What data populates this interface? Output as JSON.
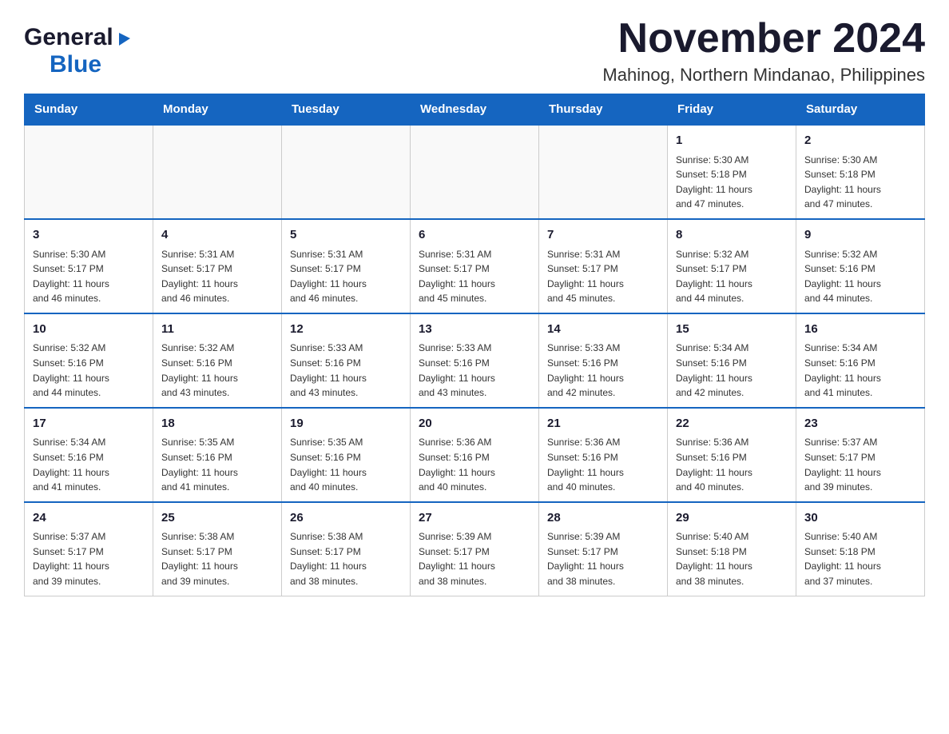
{
  "logo": {
    "general": "General",
    "blue": "Blue"
  },
  "title": "November 2024",
  "subtitle": "Mahinog, Northern Mindanao, Philippines",
  "days_of_week": [
    "Sunday",
    "Monday",
    "Tuesday",
    "Wednesday",
    "Thursday",
    "Friday",
    "Saturday"
  ],
  "weeks": [
    [
      {
        "day": "",
        "info": ""
      },
      {
        "day": "",
        "info": ""
      },
      {
        "day": "",
        "info": ""
      },
      {
        "day": "",
        "info": ""
      },
      {
        "day": "",
        "info": ""
      },
      {
        "day": "1",
        "info": "Sunrise: 5:30 AM\nSunset: 5:18 PM\nDaylight: 11 hours\nand 47 minutes."
      },
      {
        "day": "2",
        "info": "Sunrise: 5:30 AM\nSunset: 5:18 PM\nDaylight: 11 hours\nand 47 minutes."
      }
    ],
    [
      {
        "day": "3",
        "info": "Sunrise: 5:30 AM\nSunset: 5:17 PM\nDaylight: 11 hours\nand 46 minutes."
      },
      {
        "day": "4",
        "info": "Sunrise: 5:31 AM\nSunset: 5:17 PM\nDaylight: 11 hours\nand 46 minutes."
      },
      {
        "day": "5",
        "info": "Sunrise: 5:31 AM\nSunset: 5:17 PM\nDaylight: 11 hours\nand 46 minutes."
      },
      {
        "day": "6",
        "info": "Sunrise: 5:31 AM\nSunset: 5:17 PM\nDaylight: 11 hours\nand 45 minutes."
      },
      {
        "day": "7",
        "info": "Sunrise: 5:31 AM\nSunset: 5:17 PM\nDaylight: 11 hours\nand 45 minutes."
      },
      {
        "day": "8",
        "info": "Sunrise: 5:32 AM\nSunset: 5:17 PM\nDaylight: 11 hours\nand 44 minutes."
      },
      {
        "day": "9",
        "info": "Sunrise: 5:32 AM\nSunset: 5:16 PM\nDaylight: 11 hours\nand 44 minutes."
      }
    ],
    [
      {
        "day": "10",
        "info": "Sunrise: 5:32 AM\nSunset: 5:16 PM\nDaylight: 11 hours\nand 44 minutes."
      },
      {
        "day": "11",
        "info": "Sunrise: 5:32 AM\nSunset: 5:16 PM\nDaylight: 11 hours\nand 43 minutes."
      },
      {
        "day": "12",
        "info": "Sunrise: 5:33 AM\nSunset: 5:16 PM\nDaylight: 11 hours\nand 43 minutes."
      },
      {
        "day": "13",
        "info": "Sunrise: 5:33 AM\nSunset: 5:16 PM\nDaylight: 11 hours\nand 43 minutes."
      },
      {
        "day": "14",
        "info": "Sunrise: 5:33 AM\nSunset: 5:16 PM\nDaylight: 11 hours\nand 42 minutes."
      },
      {
        "day": "15",
        "info": "Sunrise: 5:34 AM\nSunset: 5:16 PM\nDaylight: 11 hours\nand 42 minutes."
      },
      {
        "day": "16",
        "info": "Sunrise: 5:34 AM\nSunset: 5:16 PM\nDaylight: 11 hours\nand 41 minutes."
      }
    ],
    [
      {
        "day": "17",
        "info": "Sunrise: 5:34 AM\nSunset: 5:16 PM\nDaylight: 11 hours\nand 41 minutes."
      },
      {
        "day": "18",
        "info": "Sunrise: 5:35 AM\nSunset: 5:16 PM\nDaylight: 11 hours\nand 41 minutes."
      },
      {
        "day": "19",
        "info": "Sunrise: 5:35 AM\nSunset: 5:16 PM\nDaylight: 11 hours\nand 40 minutes."
      },
      {
        "day": "20",
        "info": "Sunrise: 5:36 AM\nSunset: 5:16 PM\nDaylight: 11 hours\nand 40 minutes."
      },
      {
        "day": "21",
        "info": "Sunrise: 5:36 AM\nSunset: 5:16 PM\nDaylight: 11 hours\nand 40 minutes."
      },
      {
        "day": "22",
        "info": "Sunrise: 5:36 AM\nSunset: 5:16 PM\nDaylight: 11 hours\nand 40 minutes."
      },
      {
        "day": "23",
        "info": "Sunrise: 5:37 AM\nSunset: 5:17 PM\nDaylight: 11 hours\nand 39 minutes."
      }
    ],
    [
      {
        "day": "24",
        "info": "Sunrise: 5:37 AM\nSunset: 5:17 PM\nDaylight: 11 hours\nand 39 minutes."
      },
      {
        "day": "25",
        "info": "Sunrise: 5:38 AM\nSunset: 5:17 PM\nDaylight: 11 hours\nand 39 minutes."
      },
      {
        "day": "26",
        "info": "Sunrise: 5:38 AM\nSunset: 5:17 PM\nDaylight: 11 hours\nand 38 minutes."
      },
      {
        "day": "27",
        "info": "Sunrise: 5:39 AM\nSunset: 5:17 PM\nDaylight: 11 hours\nand 38 minutes."
      },
      {
        "day": "28",
        "info": "Sunrise: 5:39 AM\nSunset: 5:17 PM\nDaylight: 11 hours\nand 38 minutes."
      },
      {
        "day": "29",
        "info": "Sunrise: 5:40 AM\nSunset: 5:18 PM\nDaylight: 11 hours\nand 38 minutes."
      },
      {
        "day": "30",
        "info": "Sunrise: 5:40 AM\nSunset: 5:18 PM\nDaylight: 11 hours\nand 37 minutes."
      }
    ]
  ]
}
